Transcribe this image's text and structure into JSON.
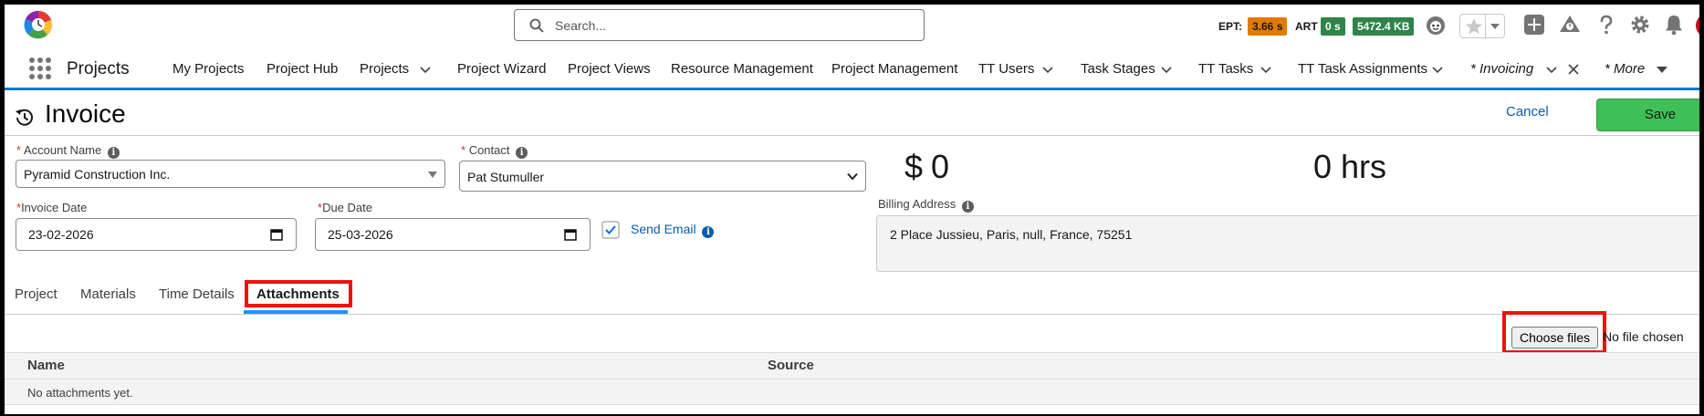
{
  "header": {
    "search_placeholder": "Search...",
    "metrics": {
      "ept_label": "EPT:",
      "ept_value": "3.66 s",
      "ept_color": "#e07b00",
      "art_label": "ART",
      "art_value": "0 s",
      "art_color": "#2e844a",
      "size_value": "5472.4 KB",
      "size_color": "#2e844a"
    },
    "icons": [
      "astro-icon",
      "favorite-star-icon",
      "favorite-dropdown-icon",
      "global-actions-plus-icon",
      "trailhead-icon",
      "help-icon",
      "setup-gear-icon",
      "notifications-bell-icon"
    ]
  },
  "nav": {
    "app_name": "Projects",
    "items": [
      {
        "label": "My Projects"
      },
      {
        "label": "Project Hub"
      },
      {
        "label": "Projects"
      },
      {
        "label": "Project Wizard"
      },
      {
        "label": "Project Views"
      },
      {
        "label": "Resource Management"
      },
      {
        "label": "Project Management"
      },
      {
        "label": "TT Users"
      },
      {
        "label": "Task Stages"
      },
      {
        "label": "TT Tasks"
      },
      {
        "label": "TT Task Assignments"
      },
      {
        "label": "* Invoicing"
      },
      {
        "label": "* More"
      }
    ],
    "accent_color": "#0176d3"
  },
  "page": {
    "title": "Invoice",
    "cancel_label": "Cancel",
    "save_label": "Save",
    "save_color": "#3fbf58"
  },
  "form": {
    "account_name_label": "Account Name",
    "account_name_value": "Pyramid Construction Inc.",
    "contact_label": "Contact",
    "contact_value": "Pat Stumuller",
    "invoice_date_label": "Invoice Date",
    "invoice_date_value": "23-02-2026",
    "due_date_label": "Due Date",
    "due_date_value": "25-03-2026",
    "send_email_label": "Send Email",
    "send_email_checked": true,
    "amount_currency": "$",
    "amount_value": "0",
    "hours_value": "0 hrs",
    "billing_address_label": "Billing Address",
    "billing_address_value": "2 Place Jussieu, Paris, null, France, 75251",
    "required_marker": "*"
  },
  "tabs": [
    {
      "label": "Project"
    },
    {
      "label": "Materials"
    },
    {
      "label": "Time Details"
    },
    {
      "label": "Attachments",
      "active": true
    }
  ],
  "attachments": {
    "choose_files_label": "Choose files",
    "no_file_text": "No file chosen",
    "columns": [
      "Name",
      "Source"
    ],
    "empty_text": "No attachments yet."
  },
  "highlight_color": "#ee1111"
}
